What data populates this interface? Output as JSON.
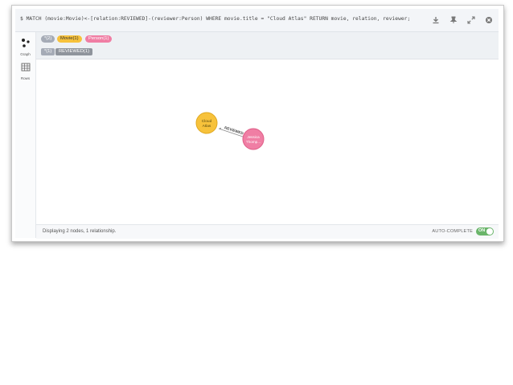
{
  "query": {
    "text": "$ MATCH (movie:Movie)<-[relation:REVIEWED]-(reviewer:Person) WHERE movie.title = \"Cloud Atlas\" RETURN movie, relation, reviewer;",
    "icons": [
      "download-icon",
      "pin-icon",
      "expand-icon",
      "close-icon"
    ]
  },
  "sidebar": {
    "tabs": [
      {
        "label": "Graph",
        "icon": "graph-icon"
      },
      {
        "label": "Rows",
        "icon": "table-icon"
      }
    ]
  },
  "legend": {
    "node_labels": [
      {
        "text": "*(2)",
        "color": "#a5abb6"
      },
      {
        "text": "Movie(1)",
        "color": "#f7c23b"
      },
      {
        "text": "Person(1)",
        "color": "#f07ea4"
      }
    ],
    "relationship_types": [
      {
        "text": "*(1)",
        "color": "#a5abb6"
      },
      {
        "text": "REVIEWED(1)",
        "color": "#8f949c"
      }
    ]
  },
  "graph": {
    "nodes": [
      {
        "id": "movie",
        "label_lines": [
          "Cloud",
          "Atlas"
        ],
        "color": "#f7c23b",
        "stroke": "#e0a820"
      },
      {
        "id": "person",
        "label_lines": [
          "Jessica",
          "Thomp..."
        ],
        "color": "#f07ea4",
        "stroke": "#de5d86"
      }
    ],
    "relationship": {
      "label": "REVIEWED"
    }
  },
  "footer": {
    "status": "Displaying 2 nodes, 1 relationship.",
    "autocomplete_label": "AUTO-COMPLETE",
    "toggle_text": "ON"
  }
}
